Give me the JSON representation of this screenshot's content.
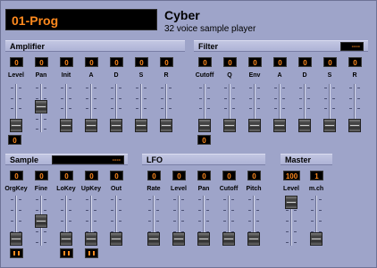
{
  "preset": {
    "name": "01-Prog"
  },
  "plugin": {
    "title": "Cyber",
    "subtitle": "32 voice sample player"
  },
  "colors": {
    "background": "#9ea4c9",
    "display_bg": "#000000",
    "display_text": "#ff8a1e"
  },
  "amplifier": {
    "title": "Amplifier",
    "params": [
      {
        "label": "Level",
        "value": "0",
        "level": 0.0
      },
      {
        "label": "Pan",
        "value": "0",
        "level": 0.55
      },
      {
        "label": "Init",
        "value": "0",
        "level": 0.0
      },
      {
        "label": "A",
        "value": "0",
        "level": 0.0
      },
      {
        "label": "D",
        "value": "0",
        "level": 0.0
      },
      {
        "label": "S",
        "value": "0",
        "level": 0.0
      },
      {
        "label": "R",
        "value": "0",
        "level": 0.0
      }
    ],
    "extra_value": "0"
  },
  "filter": {
    "title": "Filter",
    "display": "----",
    "params": [
      {
        "label": "Cutoff",
        "value": "0",
        "level": 0.0
      },
      {
        "label": "Q",
        "value": "0",
        "level": 0.0
      },
      {
        "label": "Env",
        "value": "0",
        "level": 0.0
      },
      {
        "label": "A",
        "value": "0",
        "level": 0.0
      },
      {
        "label": "D",
        "value": "0",
        "level": 0.0
      },
      {
        "label": "S",
        "value": "0",
        "level": 0.0
      },
      {
        "label": "R",
        "value": "0",
        "level": 0.0
      }
    ],
    "extra_value": "0"
  },
  "sample": {
    "title": "Sample",
    "display": "----",
    "params": [
      {
        "label": "OrgKey",
        "value": "0",
        "level": 0.0
      },
      {
        "label": "Fine",
        "value": "0",
        "level": 0.5
      },
      {
        "label": "LoKey",
        "value": "0",
        "level": 0.0
      },
      {
        "label": "UpKey",
        "value": "0",
        "level": 0.0
      },
      {
        "label": "Out",
        "value": "0",
        "level": 0.0
      }
    ]
  },
  "lfo": {
    "title": "LFO",
    "params": [
      {
        "label": "Rate",
        "value": "0",
        "level": 0.0
      },
      {
        "label": "Level",
        "value": "0",
        "level": 0.0
      },
      {
        "label": "Pan",
        "value": "0",
        "level": 0.0
      },
      {
        "label": "Cutoff",
        "value": "0",
        "level": 0.0
      },
      {
        "label": "Pitch",
        "value": "0",
        "level": 0.0
      }
    ]
  },
  "master": {
    "title": "Master",
    "params": [
      {
        "label": "Level",
        "value": "100",
        "level": 1.0
      },
      {
        "label": "m.ch",
        "value": "1",
        "level": 0.0
      }
    ]
  }
}
